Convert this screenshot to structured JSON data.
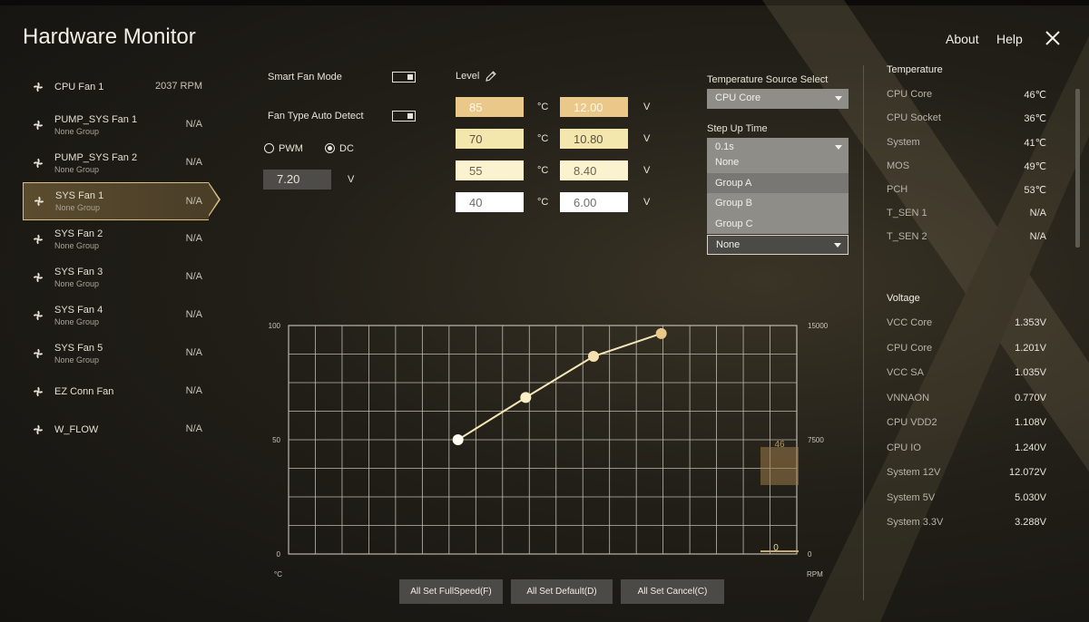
{
  "header": {
    "title": "Hardware Monitor",
    "about": "About",
    "help": "Help"
  },
  "fans": [
    {
      "name": "CPU Fan 1",
      "group": "",
      "value": "2037 RPM"
    },
    {
      "name": "PUMP_SYS Fan 1",
      "group": "None Group",
      "value": "N/A"
    },
    {
      "name": "PUMP_SYS Fan 2",
      "group": "None Group",
      "value": "N/A"
    },
    {
      "name": "SYS Fan 1",
      "group": "None Group",
      "value": "N/A"
    },
    {
      "name": "SYS Fan 2",
      "group": "None Group",
      "value": "N/A"
    },
    {
      "name": "SYS Fan 3",
      "group": "None Group",
      "value": "N/A"
    },
    {
      "name": "SYS Fan 4",
      "group": "None Group",
      "value": "N/A"
    },
    {
      "name": "SYS Fan 5",
      "group": "None Group",
      "value": "N/A"
    },
    {
      "name": "EZ Conn Fan",
      "group": "",
      "value": "N/A"
    },
    {
      "name": "W_FLOW",
      "group": "",
      "value": "N/A"
    }
  ],
  "controls": {
    "smart_fan_mode": "Smart Fan Mode",
    "fan_type_auto_detect": "Fan Type Auto Detect",
    "pwm": "PWM",
    "dc": "DC",
    "voltage_value": "7.20",
    "voltage_unit": "V",
    "level_label": "Level"
  },
  "levels": [
    {
      "temp": "85",
      "temp_unit": "°C",
      "volt": "12.00",
      "volt_unit": "V"
    },
    {
      "temp": "70",
      "temp_unit": "°C",
      "volt": "10.80",
      "volt_unit": "V"
    },
    {
      "temp": "55",
      "temp_unit": "°C",
      "volt": "8.40",
      "volt_unit": "V"
    },
    {
      "temp": "40",
      "temp_unit": "°C",
      "volt": "6.00",
      "volt_unit": "V"
    }
  ],
  "temp_source": {
    "label": "Temperature Source Select",
    "value": "CPU Core"
  },
  "step_up": {
    "label": "Step Up Time",
    "value": "0.1s",
    "options": [
      "None",
      "Group A",
      "Group B",
      "Group C"
    ],
    "highlighted": "Group A"
  },
  "group_select": {
    "value": "None"
  },
  "chart_data": {
    "type": "line",
    "ylim_left": [
      0,
      100
    ],
    "left_ticks": [
      "100",
      "50",
      "0"
    ],
    "ylim_right": [
      0,
      15000
    ],
    "right_ticks": [
      "15000",
      "7500",
      "0"
    ],
    "xlabel": "°C",
    "ylabel_right": "RPM",
    "grid": true,
    "x": [
      40,
      55,
      70,
      85
    ],
    "y": [
      50,
      68.5,
      86.5,
      96.5
    ],
    "gauge_bar_value": "46",
    "gauge_bar_min": "0"
  },
  "buttons": {
    "full_speed": "All Set FullSpeed(F)",
    "default": "All Set Default(D)",
    "cancel": "All Set Cancel(C)"
  },
  "temperature": {
    "title": "Temperature",
    "rows": [
      {
        "name": "CPU Core",
        "value": "46℃"
      },
      {
        "name": "CPU Socket",
        "value": "36℃"
      },
      {
        "name": "System",
        "value": "41℃"
      },
      {
        "name": "MOS",
        "value": "49℃"
      },
      {
        "name": "PCH",
        "value": "53℃"
      },
      {
        "name": "T_SEN 1",
        "value": "N/A"
      },
      {
        "name": "T_SEN 2",
        "value": "N/A"
      }
    ]
  },
  "voltage": {
    "title": "Voltage",
    "rows": [
      {
        "name": "VCC Core",
        "value": "1.353V"
      },
      {
        "name": "CPU Core",
        "value": "1.201V"
      },
      {
        "name": "VCC SA",
        "value": "1.035V"
      },
      {
        "name": "VNNAON",
        "value": "0.770V"
      },
      {
        "name": "CPU VDD2",
        "value": "1.108V"
      },
      {
        "name": "CPU IO",
        "value": "1.240V"
      },
      {
        "name": "System 12V",
        "value": "12.072V"
      },
      {
        "name": "System 5V",
        "value": "5.030V"
      },
      {
        "name": "System 3.3V",
        "value": "3.288V"
      }
    ]
  },
  "colors": {
    "accent": "#d8bf82",
    "level_high": "#e9c88a",
    "level_mid": "#f3e7ae",
    "level_low": "#fbf3cf",
    "curve": "#f4e8b8"
  }
}
